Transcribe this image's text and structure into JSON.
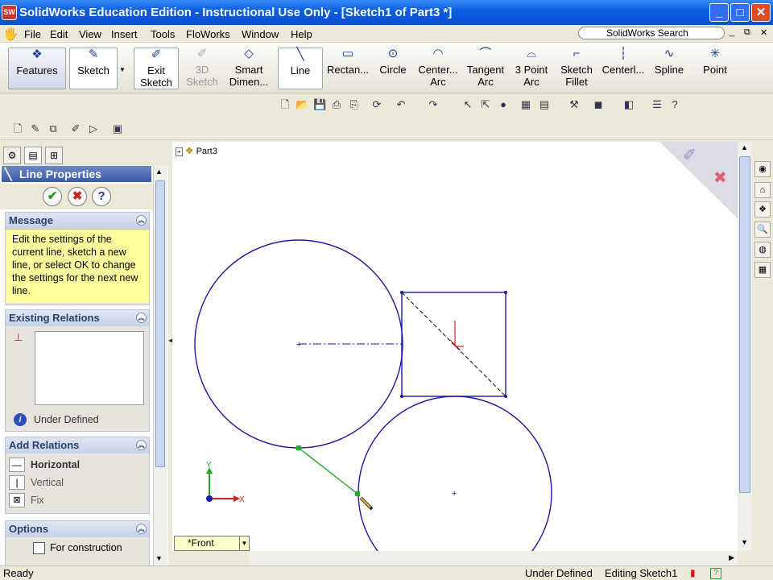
{
  "window": {
    "title": "SolidWorks Education Edition - Instructional Use Only - [Sketch1 of Part3 *]",
    "app_icon": "SW"
  },
  "menu": {
    "items": [
      "File",
      "Edit",
      "View",
      "Insert",
      "Tools",
      "FloWorks",
      "Window",
      "Help"
    ],
    "search": "SolidWorks Search"
  },
  "command_manager": {
    "features": "Features",
    "sketch": "Sketch",
    "exit_sketch": [
      "Exit",
      "Sketch"
    ],
    "sketch_3d": [
      "3D",
      "Sketch"
    ],
    "smart_dim": [
      "Smart",
      "Dimen..."
    ],
    "line": "Line",
    "rectangle": "Rectan...",
    "circle": "Circle",
    "center_arc": [
      "Center...",
      "Arc"
    ],
    "tangent_arc": [
      "Tangent",
      "Arc"
    ],
    "three_point_arc": [
      "3 Point",
      "Arc"
    ],
    "sketch_fillet": [
      "Sketch",
      "Fillet"
    ],
    "centerline": "Centerl...",
    "spline": "Spline",
    "point": "Point"
  },
  "panel": {
    "title": "Line Properties",
    "message": {
      "header": "Message",
      "text": "Edit the settings of the current line, sketch a new line, or select OK to change the settings for the next new line."
    },
    "existing_relations": {
      "header": "Existing Relations",
      "status": "Under Defined"
    },
    "add_relations": {
      "header": "Add Relations",
      "items": [
        "Horizontal",
        "Vertical",
        "Fix"
      ]
    },
    "options": {
      "header": "Options",
      "for_construction": "For construction"
    }
  },
  "tree": {
    "root": "Part3"
  },
  "view": {
    "label": "*Front",
    "triad_x": "X",
    "triad_y": "Y"
  },
  "status": {
    "left": "Ready",
    "defined": "Under Defined",
    "editing": "Editing Sketch1"
  },
  "colors": {
    "sketch": "#1a1aa6",
    "active_line": "#22aa22",
    "title_bar": "#0a5fe0"
  }
}
